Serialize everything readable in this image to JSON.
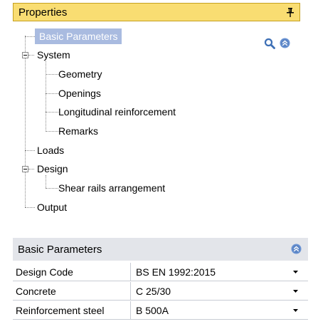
{
  "panel": {
    "title": "Properties"
  },
  "tree": {
    "basic_parameters": "Basic Parameters",
    "system": "System",
    "geometry": "Geometry",
    "openings": "Openings",
    "longitudinal_reinforcement": "Longitudinal reinforcement",
    "remarks": "Remarks",
    "loads": "Loads",
    "design": "Design",
    "shear_rails_arrangement": "Shear rails arrangement",
    "output": "Output"
  },
  "grid": {
    "title": "Basic Parameters",
    "rows": [
      {
        "label": "Design Code",
        "value": "BS EN 1992:2015"
      },
      {
        "label": "Concrete",
        "value": "C 25/30"
      },
      {
        "label": "Reinforcement steel",
        "value": "B 500A"
      }
    ]
  },
  "colors": {
    "header_bg": "#f9dd72",
    "selected_bg": "#a9bbe0",
    "grid_header_bg": "#e3e5ea",
    "accent_blue": "#5b85c6"
  },
  "icons": [
    "pin-icon",
    "search-icon",
    "collapse-up-icon",
    "dropdown-arrow-icon",
    "tree-expander-icon"
  ]
}
